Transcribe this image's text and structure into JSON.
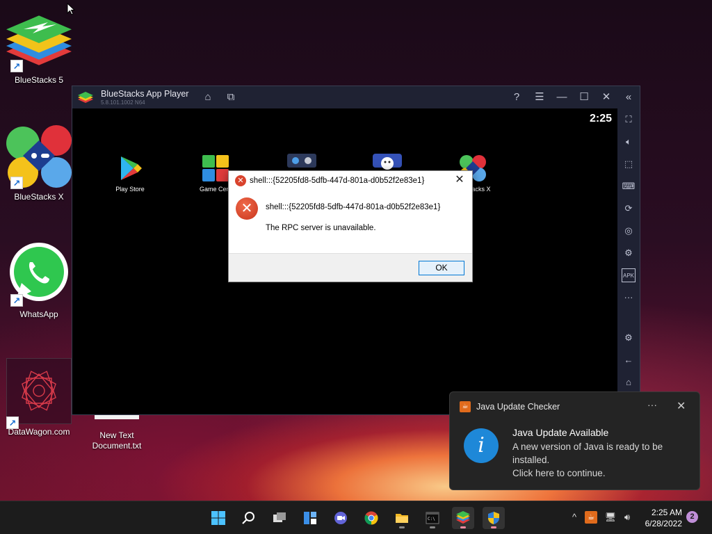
{
  "desktop": {
    "icons": [
      {
        "label": "BlueStacks 5"
      },
      {
        "label": "BlueStacks X"
      },
      {
        "label": "WhatsApp"
      },
      {
        "label": "DataWagon.com"
      },
      {
        "label": "New Text Document.txt"
      }
    ]
  },
  "bluestacks": {
    "title": "BlueStacks App Player",
    "version": "5.8.101.1002  N64",
    "clock": "2:25",
    "apps": [
      {
        "label": "Play Store"
      },
      {
        "label": "Game Cent"
      },
      {
        "label": ""
      },
      {
        "label": ""
      },
      {
        "label": "acks X"
      }
    ]
  },
  "dialog": {
    "title": "shell:::{52205fd8-5dfb-447d-801a-d0b52f2e83e1}",
    "path": "shell:::{52205fd8-5dfb-447d-801a-d0b52f2e83e1}",
    "message": "The RPC server is unavailable.",
    "ok_label": "OK"
  },
  "notification": {
    "app": "Java Update Checker",
    "heading": "Java Update Available",
    "body": "A new version of Java is ready to be installed.\nClick here to continue."
  },
  "taskbar": {
    "time": "2:25 AM",
    "date": "6/28/2022",
    "notification_count": "2"
  },
  "colors": {
    "error_red": "#d9432d",
    "accent_blue": "#0078d4",
    "info_blue": "#1e88d8"
  }
}
